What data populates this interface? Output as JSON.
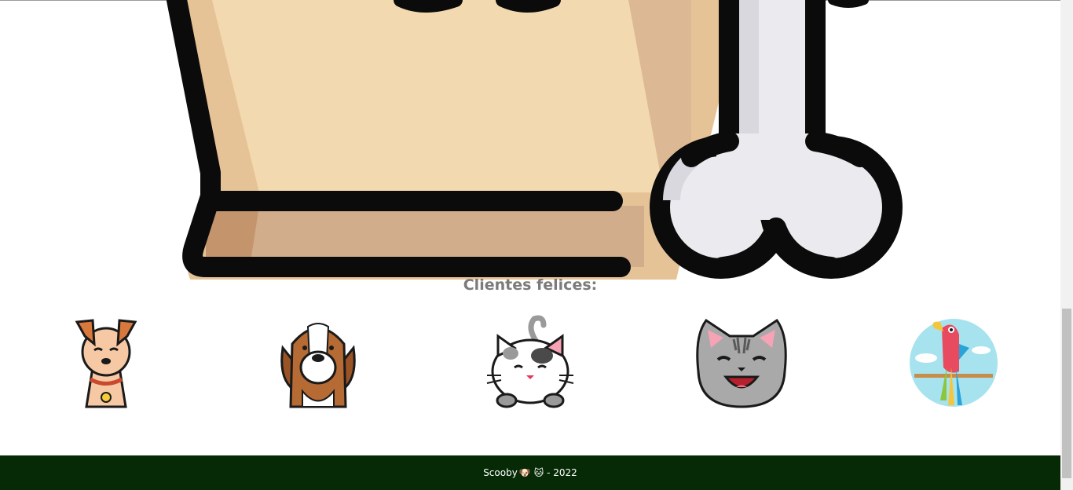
{
  "hero": {
    "icon": "bone-biscuit-icon"
  },
  "clients": {
    "title": "Clientes felices:",
    "items": [
      {
        "icon": "puppy-icon"
      },
      {
        "icon": "saint-bernard-icon"
      },
      {
        "icon": "calico-cat-icon"
      },
      {
        "icon": "tabby-cat-icon"
      },
      {
        "icon": "parrot-icon"
      }
    ]
  },
  "footer": {
    "brand": "Scooby",
    "dog_emoji": "🐶",
    "cat_emoji": "🐱",
    "separator": " - ",
    "year": "2022"
  },
  "colors": {
    "footer_bg": "#062a05",
    "title": "#7b7b7b",
    "biscuit": "#f3d9af",
    "bone": "#ebeaef"
  }
}
